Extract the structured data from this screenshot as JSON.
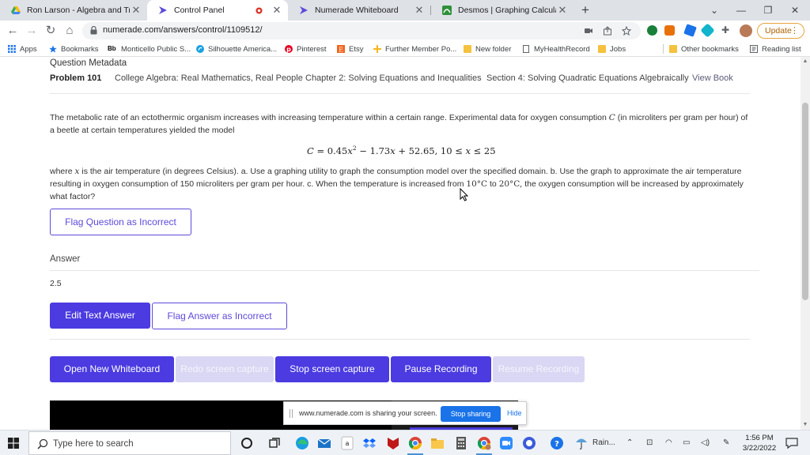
{
  "browser": {
    "tabs": [
      {
        "title": "Ron Larson - Algebra and Trigono",
        "favicon": "google-drive-icon"
      },
      {
        "title": "Control Panel",
        "favicon": "numerade-icon"
      },
      {
        "title": "Numerade Whiteboard",
        "favicon": "numerade-icon"
      },
      {
        "title": "Desmos | Graphing Calculator",
        "favicon": "desmos-icon"
      }
    ],
    "url": "numerade.com/answers/control/1109512/",
    "update_label": "Update"
  },
  "bookmarks": [
    {
      "label": "Apps",
      "icon": "apps-grid-icon"
    },
    {
      "label": "Bookmarks",
      "icon": "star-icon"
    },
    {
      "label": "Monticello Public S...",
      "icon": "bb-icon"
    },
    {
      "label": "Silhouette America...",
      "icon": "silhouette-icon"
    },
    {
      "label": "Pinterest",
      "icon": "pinterest-icon"
    },
    {
      "label": "Etsy",
      "icon": "etsy-icon"
    },
    {
      "label": "Further Member Po...",
      "icon": "further-icon"
    },
    {
      "label": "New folder",
      "icon": "folder-icon"
    },
    {
      "label": "MyHealthRecord",
      "icon": "page-icon"
    },
    {
      "label": "Jobs",
      "icon": "folder-icon"
    },
    {
      "label": "Other bookmarks",
      "icon": "folder-icon"
    },
    {
      "label": "Reading list",
      "icon": "reading-list-icon"
    }
  ],
  "metadata": {
    "heading": "Question Metadata",
    "problem": "Problem 101",
    "book": "College Algebra: Real Mathematics, Real People",
    "chapter": "Chapter 2: Solving Equations and Inequalities",
    "section": "Section 4: Solving Quadratic Equations Algebraically",
    "view_book": "View Book"
  },
  "question": {
    "p1a": "The metabolic rate of an ectothermic organism increases with increasing temperature within a certain range. Experimental data for oxygen consumption",
    "p1var": "C",
    "p1b": "(in microliters per gram per hour) of a beetle at certain temperatures yielded the model",
    "p2a": "where",
    "p2var": "x",
    "p2b": "is the air temperature (in degrees Celsius). a. Use a graphing utility to graph the consumption model over the specified domain. b. Use the graph to approximate the air temperature resulting in oxygen consumption of 150 microliters per gram per hour. c. When the temperature is increased from",
    "p2t1": "10°C",
    "p2to": "to",
    "p2t2": "20°C,",
    "p2c": "the oxygen consumption will be increased by approximately what factor?",
    "flag_label": "Flag Question as Incorrect"
  },
  "answer": {
    "heading": "Answer",
    "value": "2.5",
    "edit_label": "Edit Text Answer",
    "flag_label": "Flag Answer as Incorrect"
  },
  "controls": {
    "open_whiteboard": "Open New Whiteboard",
    "redo_capture": "Redo screen capture",
    "stop_capture": "Stop screen capture",
    "pause_recording": "Pause Recording",
    "resume_recording": "Resume Recording"
  },
  "share_bar": {
    "message": "www.numerade.com is sharing your screen.",
    "stop_label": "Stop sharing",
    "hide_label": "Hide"
  },
  "taskbar": {
    "search_placeholder": "Type here to search",
    "weather": "Rain...",
    "time": "1:56 PM",
    "date": "3/22/2022"
  },
  "colors": {
    "accent": "#4b3be0",
    "accent_disabled": "#d9d7f3"
  }
}
